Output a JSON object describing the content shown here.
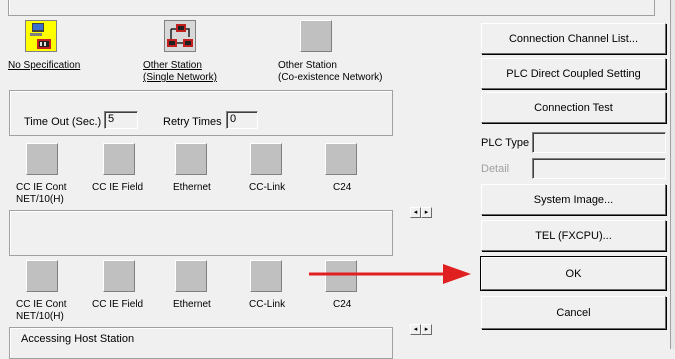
{
  "top_icons": [
    {
      "label_line1": "No Specification",
      "label_line2": "",
      "icon": "monitor-plc-icon"
    },
    {
      "label_line1": "Other Station",
      "label_line2": "(Single Network)",
      "icon": "network-plc-icon"
    },
    {
      "label_line1": "Other Station",
      "label_line2": "(Co-existence Network)",
      "icon": "blank-tile-icon"
    }
  ],
  "timeout": {
    "label": "Time Out (Sec.)",
    "value": "5"
  },
  "retry": {
    "label": "Retry Times",
    "value": "0"
  },
  "network_row1": [
    {
      "line1": "CC IE Cont",
      "line2": "NET/10(H)"
    },
    {
      "line1": "CC IE Field",
      "line2": ""
    },
    {
      "line1": "Ethernet",
      "line2": ""
    },
    {
      "line1": "CC-Link",
      "line2": ""
    },
    {
      "line1": "C24",
      "line2": ""
    }
  ],
  "network_row2": [
    {
      "line1": "CC IE Cont",
      "line2": "NET/10(H)"
    },
    {
      "line1": "CC IE Field",
      "line2": ""
    },
    {
      "line1": "Ethernet",
      "line2": ""
    },
    {
      "line1": "CC-Link",
      "line2": ""
    },
    {
      "line1": "C24",
      "line2": ""
    }
  ],
  "scroll_arrows": {
    "left": "◂",
    "right": "▸"
  },
  "accessing_label": "Accessing Host Station",
  "right_panel": {
    "connection_channel_list": "Connection Channel List...",
    "plc_direct_coupled": "PLC Direct Coupled Setting",
    "connection_test": "Connection Test",
    "plc_type_label": "PLC Type",
    "plc_type_value": "",
    "detail_label": "Detail",
    "detail_value": "",
    "system_image": "System Image...",
    "tel": "TEL (FXCPU)...",
    "ok": "OK",
    "cancel": "Cancel"
  },
  "colors": {
    "annotation_arrow": "#e02020",
    "dialog_bg": "#f0f0f0"
  }
}
